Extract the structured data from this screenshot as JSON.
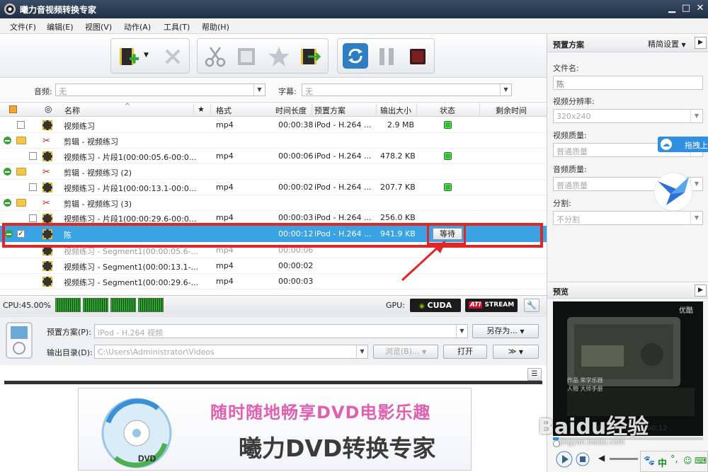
{
  "app": {
    "title": "曦力音视频转换专家"
  },
  "window_buttons": {
    "minimize": "▁",
    "maximize": "□",
    "close": "✕"
  },
  "menu": [
    "文件(F)",
    "编辑(E)",
    "视图(V)",
    "动作(A)",
    "工具(T)",
    "帮助(H)"
  ],
  "toolbar_icons": [
    "add-video-icon",
    "delete-icon",
    "scissors-icon",
    "film-edit-icon",
    "effect-star-icon",
    "merge-icon",
    "convert-icon",
    "pause-icon",
    "stop-icon"
  ],
  "audio": {
    "label": "音频:",
    "value": "无"
  },
  "subtitle": {
    "label": "字幕:",
    "value": "无"
  },
  "columns": {
    "name": "名称",
    "star": "★",
    "format": "格式",
    "duration": "时间长度",
    "preset": "预置方案",
    "size": "输出大小",
    "status": "状态",
    "remaining": "剩余时间"
  },
  "rows": [
    {
      "kind": "file",
      "name": "视频练习",
      "format": "mp4",
      "duration": "00:00:38",
      "preset": "iPod - H.264 ...",
      "size": "2.9 MB",
      "status": "green"
    },
    {
      "kind": "clip-group",
      "name": "剪辑 - 视频练习"
    },
    {
      "kind": "clip",
      "name": "视频练习 - 片段1(00:00:05.6-00:0...",
      "format": "mp4",
      "duration": "00:00:06",
      "preset": "iPod - H.264 ...",
      "size": "478.2 KB",
      "status": "green"
    },
    {
      "kind": "clip-group",
      "name": "剪辑 - 视频练习 (2)"
    },
    {
      "kind": "clip",
      "name": "视频练习 - 片段1(00:00:13.1-00:0...",
      "format": "mp4",
      "duration": "00:00:02",
      "preset": "iPod - H.264 ...",
      "size": "207.7 KB",
      "status": "green"
    },
    {
      "kind": "clip-group",
      "name": "剪辑 - 视频练习 (3)"
    },
    {
      "kind": "clip",
      "name": "视频练习 - 片段1(00:00:29.6-00:0...",
      "format": "mp4",
      "duration": "00:00:03",
      "preset": "iPod - H.264 ...",
      "size": "256.0 KB",
      "status": "green"
    },
    {
      "kind": "selected",
      "name": "陈",
      "duration": "00:00:12",
      "preset": "iPod - H.264 ...",
      "size": "941.9 KB",
      "status_text": "等待"
    },
    {
      "kind": "segment",
      "name": "视频练习 - Segment1(00:00:05.6-...",
      "format": "mp4",
      "duration": "00:00:06"
    },
    {
      "kind": "segment",
      "name": "视频练习 - Segment1(00:00:13.1-...",
      "format": "mp4",
      "duration": "00:00:02"
    },
    {
      "kind": "segment",
      "name": "视频练习 - Segment1(00:00:29.6-...",
      "format": "mp4",
      "duration": "00:00:03"
    }
  ],
  "cpu": {
    "label": "CPU:45.00%",
    "usage_percent": 45
  },
  "gpu": {
    "label": "GPU:",
    "cuda": "CUDA",
    "ati_a": "ATI",
    "ati_b": "STREAM"
  },
  "settings": {
    "preset_label": "预置方案(P):",
    "preset_value": "iPod - H.264 视频",
    "save_as": "另存为...",
    "outdir_label": "输出目录(D):",
    "outdir_value": "C:\\Users\\Administrator\\Videos",
    "browse": "浏览(B)...",
    "open": "打开",
    "more": "≫"
  },
  "banner": {
    "line1": "随时随地畅享DVD电影乐趣",
    "line2": "曦力DVD转换专家",
    "disc_text": "DVD"
  },
  "right_panel": {
    "title": "预置方案",
    "mode": "精简设置",
    "filename_label": "文件名:",
    "filename_value": "陈",
    "resolution_label": "视频分辨率:",
    "resolution_value": "320x240",
    "vquality_label": "视频质量:",
    "vquality_value": "普通质量",
    "aquality_label": "音频质量:",
    "aquality_value": "普通质量",
    "split_label": "分割:",
    "split_value": "不分割",
    "upload_label": "拖拽上",
    "preview_title": "预览",
    "preview_overlay": "优酷",
    "preview_caption_a": "作品 荣学乐器",
    "preview_caption_b": "人物 大师手册",
    "time": "00:00:06 / 00:00:12"
  },
  "watermark": {
    "brand": "Baidu经验",
    "url": "jingyan.baidu.com"
  },
  "ime": {
    "label": "中"
  },
  "colors": {
    "selection": "#3aa3e3",
    "annotation": "#e22525",
    "status_ok": "#27c227"
  }
}
